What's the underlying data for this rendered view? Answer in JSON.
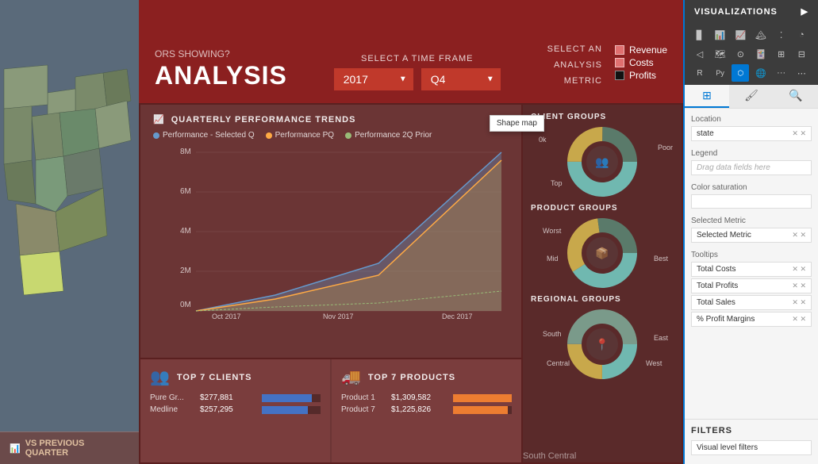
{
  "header": {
    "ors_label": "ORS SHOWING?",
    "title": "ANALYSIS",
    "select_timeframe": "SELECT A TIME FRAME",
    "year_value": "2017",
    "quarter_value": "Q4",
    "select_analysis": "SELECT AN",
    "analysis_label": "ANALYSIS",
    "metric_label": "METRIC",
    "metrics": [
      {
        "label": "Revenue",
        "color": "#e07070"
      },
      {
        "label": "Costs",
        "color": "#e07070"
      },
      {
        "label": "Profits",
        "color": "#333"
      }
    ]
  },
  "quarterly": {
    "title": "QUARTERLY PERFORMANCE TRENDS",
    "legend": [
      {
        "label": "Performance - Selected Q",
        "color": "#6699cc"
      },
      {
        "label": "Performance PQ",
        "color": "#ffaa44"
      },
      {
        "label": "Performance 2Q Prior",
        "color": "#99bb77"
      }
    ],
    "y_labels": [
      "8M",
      "6M",
      "4M",
      "2M",
      "0M"
    ],
    "x_labels": [
      "Oct 2017",
      "Nov 2017",
      "Dec 2017"
    ]
  },
  "client_groups": {
    "title": "CLIENT GROUPS",
    "labels": {
      "top": "Top",
      "poor": "Poor"
    }
  },
  "product_groups": {
    "title": "PRODUCT GROUPS",
    "labels": {
      "worst": "Worst",
      "mid": "Mid",
      "best": "Best"
    }
  },
  "regional_groups": {
    "title": "REGIONAL GROUPS",
    "labels": {
      "south": "South",
      "east": "East",
      "west": "West",
      "central": "Central"
    }
  },
  "top_clients": {
    "title": "TOP 7 CLIENTS",
    "items": [
      {
        "name": "Pure Gr...",
        "value": "$277,881",
        "bar_pct": 85
      },
      {
        "name": "Medline",
        "value": "$257,295",
        "bar_pct": 78
      }
    ]
  },
  "top_products": {
    "title": "TOP 7 PRODUCTS",
    "items": [
      {
        "name": "Product 1",
        "value": "$1,309,582",
        "bar_pct": 100
      },
      {
        "name": "Product 7",
        "value": "$1,225,826",
        "bar_pct": 93
      }
    ]
  },
  "vs_previous": {
    "label": "VS PREVIOUS QUARTER"
  },
  "visualizations": {
    "header": "VISUALIZATIONS",
    "tabs": [
      {
        "label": "⊞",
        "name": "fields"
      },
      {
        "label": "🖌",
        "name": "format"
      },
      {
        "label": "🔍",
        "name": "analytics"
      }
    ],
    "fields": {
      "location": {
        "label": "Location",
        "value": "state",
        "has_x": true
      },
      "legend": {
        "label": "Legend",
        "placeholder": "Drag data fields here"
      },
      "color_saturation": {
        "label": "Color saturation",
        "placeholder": ""
      },
      "selected_metric": {
        "label": "Selected Metric",
        "value": "Selected Metric",
        "has_x": true
      },
      "tooltips": {
        "label": "Tooltips",
        "items": [
          {
            "value": "Total Costs",
            "has_x": true
          },
          {
            "value": "Total Profits",
            "has_x": true
          },
          {
            "value": "Total Sales",
            "has_x": true
          },
          {
            "value": "% Profit Margins",
            "has_x": true
          }
        ]
      }
    },
    "filters": {
      "title": "FILTERS",
      "items": [
        {
          "label": "Visual level filters"
        }
      ]
    },
    "tooltip_popup": "Shape map"
  },
  "colors": {
    "accent_blue": "#0078d4",
    "bar_blue": "#4472c4",
    "bar_gold": "#ed7d31",
    "donut_teal": "#70b8b0",
    "donut_gold": "#c8a84b",
    "donut_dark": "#5a7a6a"
  }
}
